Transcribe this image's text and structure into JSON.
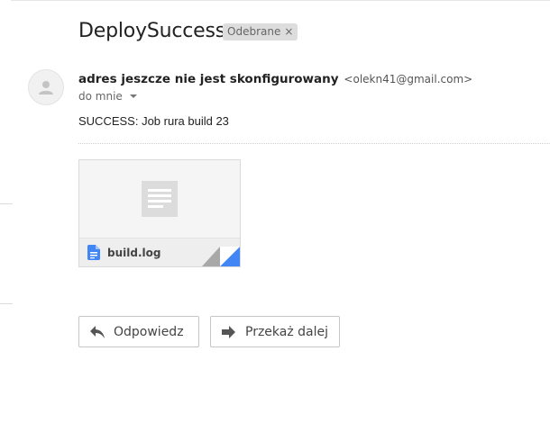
{
  "email": {
    "subject": "DeploySuccess",
    "label": "Odebrane",
    "label_remove": "×",
    "sender_name": "adres jeszcze nie jest skonfigurowany",
    "sender_email": "<olekn41@gmail.com>",
    "recipient": "do mnie",
    "body": "SUCCESS: Job rura build 23"
  },
  "attachment": {
    "filename": "build.log"
  },
  "actions": {
    "reply_label": "Odpowiedz",
    "forward_label": "Przekaż dalej"
  },
  "colors": {
    "file_icon_blue": "#4285f4",
    "chip_bg": "#dddddd",
    "button_border": "#c6c6c6"
  },
  "icons": [
    "person-icon",
    "document-preview-icon",
    "file-icon",
    "reply-icon",
    "forward-icon"
  ]
}
